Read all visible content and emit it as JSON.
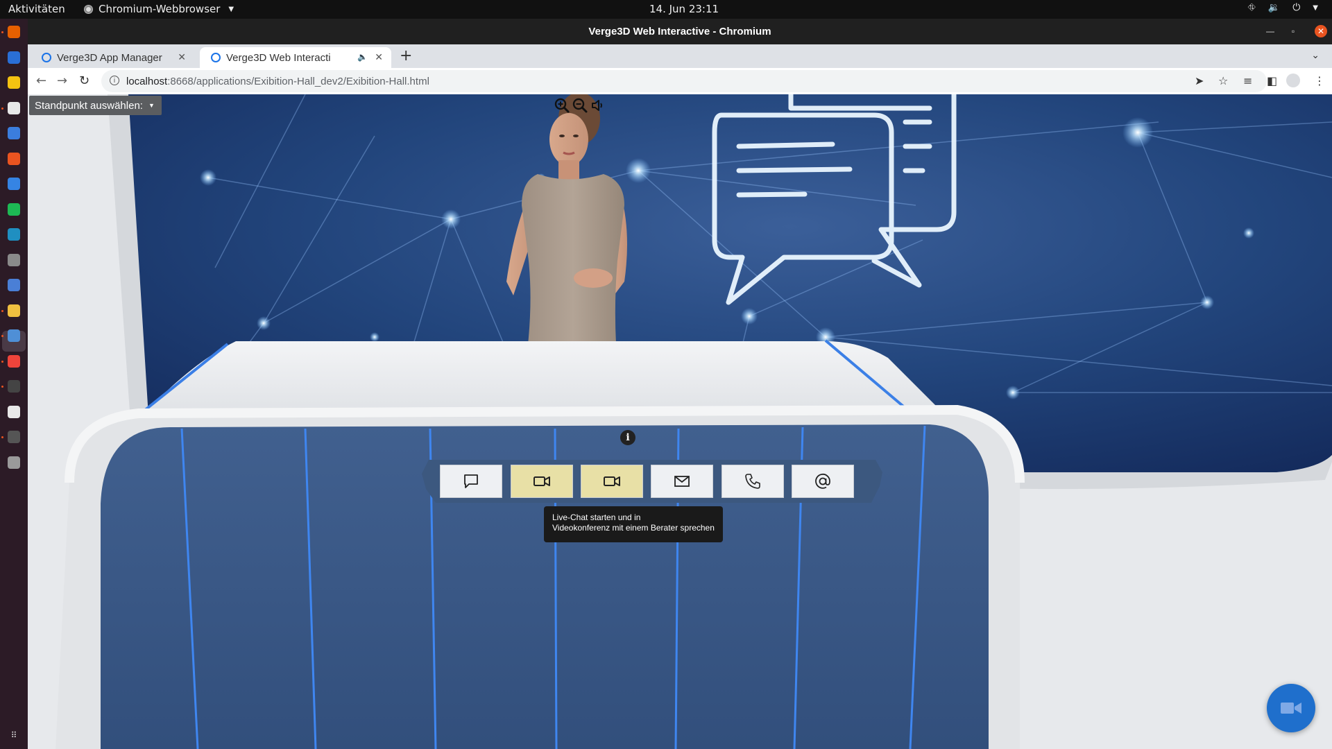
{
  "topbar": {
    "activities": "Aktivitäten",
    "app_menu": "Chromium-Webbrowser",
    "clock": "14. Jun  23:11"
  },
  "dock": {
    "apps": [
      {
        "icon": "firefox-icon",
        "color": "#e66000"
      },
      {
        "icon": "thunderbird-icon",
        "color": "#2a6fd6"
      },
      {
        "icon": "rhythmbox-icon",
        "color": "#f5c211"
      },
      {
        "icon": "files-icon",
        "color": "#e8e8e8"
      },
      {
        "icon": "libreoffice-writer-icon",
        "color": "#3b7ddd"
      },
      {
        "icon": "software-center-icon",
        "color": "#e95420"
      },
      {
        "icon": "help-icon",
        "color": "#3584e4"
      },
      {
        "icon": "spotify-icon",
        "color": "#1db954"
      },
      {
        "icon": "editor-icon",
        "color": "#1f8fc1"
      },
      {
        "icon": "gimp-icon",
        "color": "#8a8a8a"
      },
      {
        "icon": "app-window-icon",
        "color": "#4a7fd6"
      },
      {
        "icon": "notes-icon",
        "color": "#f0c040"
      },
      {
        "icon": "chromium-icon",
        "color": "#4f8fd6"
      },
      {
        "icon": "anydesk-icon",
        "color": "#ef443b"
      },
      {
        "icon": "terminal-icon",
        "color": "#444444"
      },
      {
        "icon": "text-editor-icon",
        "color": "#e8e8e8"
      },
      {
        "icon": "system-monitor-icon",
        "color": "#555555"
      },
      {
        "icon": "drive-icon",
        "color": "#9a9a9a"
      }
    ]
  },
  "window": {
    "title": "Verge3D Web Interactive - Chromium"
  },
  "tabs": [
    {
      "label": "Verge3D App Manager",
      "active": false
    },
    {
      "label": "Verge3D Web Interacti",
      "active": true,
      "audio": true
    }
  ],
  "address": {
    "host": "localhost",
    "path": ":8668/applications/Exibition-Hall_dev2/Exibition-Hall.html"
  },
  "app": {
    "viewpoint_label": "Standpunkt auswählen:",
    "info_label": "i",
    "actions": [
      {
        "name": "chat",
        "icon": "chat-bubble-icon",
        "highlighted": false
      },
      {
        "name": "video-chat",
        "icon": "video-camera-icon",
        "highlighted": true
      },
      {
        "name": "video-conference",
        "icon": "video-camera-icon",
        "highlighted": true
      },
      {
        "name": "email",
        "icon": "envelope-icon",
        "highlighted": false
      },
      {
        "name": "phone",
        "icon": "phone-icon",
        "highlighted": false
      },
      {
        "name": "contact-at",
        "icon": "at-sign-icon",
        "highlighted": false
      }
    ],
    "tooltip_line1": "Live-Chat starten und in",
    "tooltip_line2": "Videokonferenz mit einem Berater sprechen"
  },
  "colors": {
    "accent_blue": "#1f6fcc",
    "highlight_button": "#e8e0a6",
    "desk_panel": "#3c5a8a",
    "screen_bg": "#1e3968"
  }
}
